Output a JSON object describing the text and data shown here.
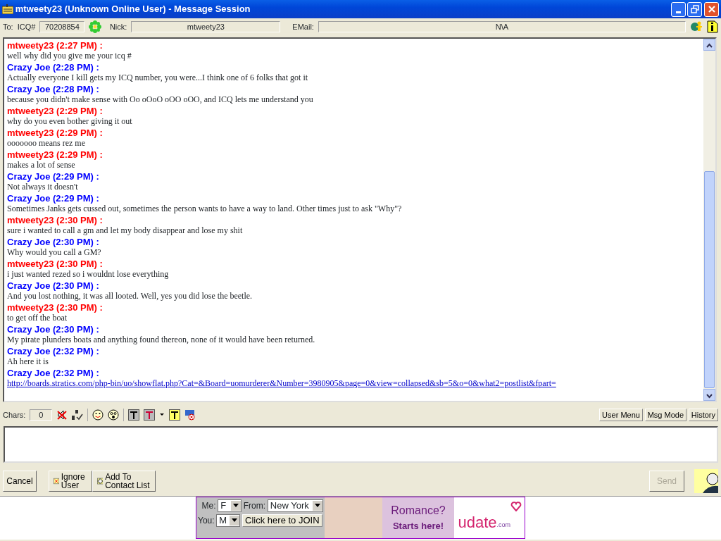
{
  "window": {
    "title": "mtweety23 (Unknown Online User) - Message Session"
  },
  "info_bar": {
    "to_label": "To:",
    "icq_label": "ICQ#",
    "icq_number": "70208854",
    "nick_label": "Nick:",
    "nick": "mtweety23",
    "email_label": "EMail:",
    "email": "N\\A"
  },
  "messages": [
    {
      "sender": "mtweety23 (2:27 PM) :",
      "color": "#ff0000",
      "kind": "text",
      "text": "well why did you give me your icq #"
    },
    {
      "sender": "Crazy Joe (2:28 PM) :",
      "color": "#0000ff",
      "kind": "text",
      "text": "Actually everyone I kill gets my ICQ number, you were...I think one of 6 folks that got it"
    },
    {
      "sender": "Crazy Joe (2:28 PM) :",
      "color": "#0000ff",
      "kind": "text",
      "text": "because you didn't make sense with Oo oOoO oOO oOO, and ICQ lets me understand you"
    },
    {
      "sender": "mtweety23 (2:29 PM) :",
      "color": "#ff0000",
      "kind": "text",
      "text": "why do you even bother giving it out"
    },
    {
      "sender": "mtweety23 (2:29 PM) :",
      "color": "#ff0000",
      "kind": "text",
      "text": "ooooooo  means rez me"
    },
    {
      "sender": "mtweety23 (2:29 PM) :",
      "color": "#ff0000",
      "kind": "text",
      "text": "makes a lot of sense"
    },
    {
      "sender": "Crazy Joe (2:29 PM) :",
      "color": "#0000ff",
      "kind": "text",
      "text": "Not always it doesn't"
    },
    {
      "sender": "Crazy Joe (2:29 PM) :",
      "color": "#0000ff",
      "kind": "text",
      "text": "Sometimes Janks gets cussed out, sometimes the person wants to have a way to land. Other times just to ask \"Why\"?"
    },
    {
      "sender": "mtweety23 (2:30 PM) :",
      "color": "#ff0000",
      "kind": "text",
      "text": "sure i wanted to call a gm and let my body disappear and lose my shit"
    },
    {
      "sender": "Crazy Joe (2:30 PM) :",
      "color": "#0000ff",
      "kind": "text",
      "text": "Why would you call a GM?"
    },
    {
      "sender": "mtweety23 (2:30 PM) :",
      "color": "#ff0000",
      "kind": "text",
      "text": "i just wanted rezed so i wouldnt lose everything"
    },
    {
      "sender": "Crazy Joe (2:30 PM) :",
      "color": "#0000ff",
      "kind": "text",
      "text": "And you lost nothing, it was all looted. Well, yes you did lose the beetle."
    },
    {
      "sender": "mtweety23 (2:30 PM) :",
      "color": "#ff0000",
      "kind": "text",
      "text": "to get off the boat"
    },
    {
      "sender": "Crazy Joe (2:30 PM) :",
      "color": "#0000ff",
      "kind": "text",
      "text": "My pirate plunders boats and anything found thereon, none of it would have been returned."
    },
    {
      "sender": "Crazy Joe (2:32 PM) :",
      "color": "#0000ff",
      "kind": "text",
      "text": "Ah here it is"
    },
    {
      "sender": "Crazy Joe (2:32 PM) :",
      "color": "#0000ff",
      "kind": "link",
      "text": "http://boards.stratics.com/php-bin/uo/showflat.php?Cat=&Board=uomurderer&Number=3980905&page=0&view=collapsed&sb=5&o=0&what2=postlist&fpart="
    }
  ],
  "toolbar": {
    "chars_label": "Chars:",
    "chars_count": "0",
    "buttons": [
      "User Menu",
      "Msg Mode",
      "History"
    ]
  },
  "actions": {
    "cancel": "Cancel",
    "ignore": "Ignore User",
    "add": "Add To Contact List",
    "send": "Send",
    "send_disabled": true
  },
  "ad": {
    "me_label": "Me:",
    "me_value": "F",
    "from_label": "From:",
    "from_value": "New York",
    "you_label": "You:",
    "you_value": "M",
    "join": "Click here to JOIN",
    "headline": "Romance?",
    "subline": "Starts here!",
    "logo": "udate",
    "logo_suffix": ".com"
  }
}
